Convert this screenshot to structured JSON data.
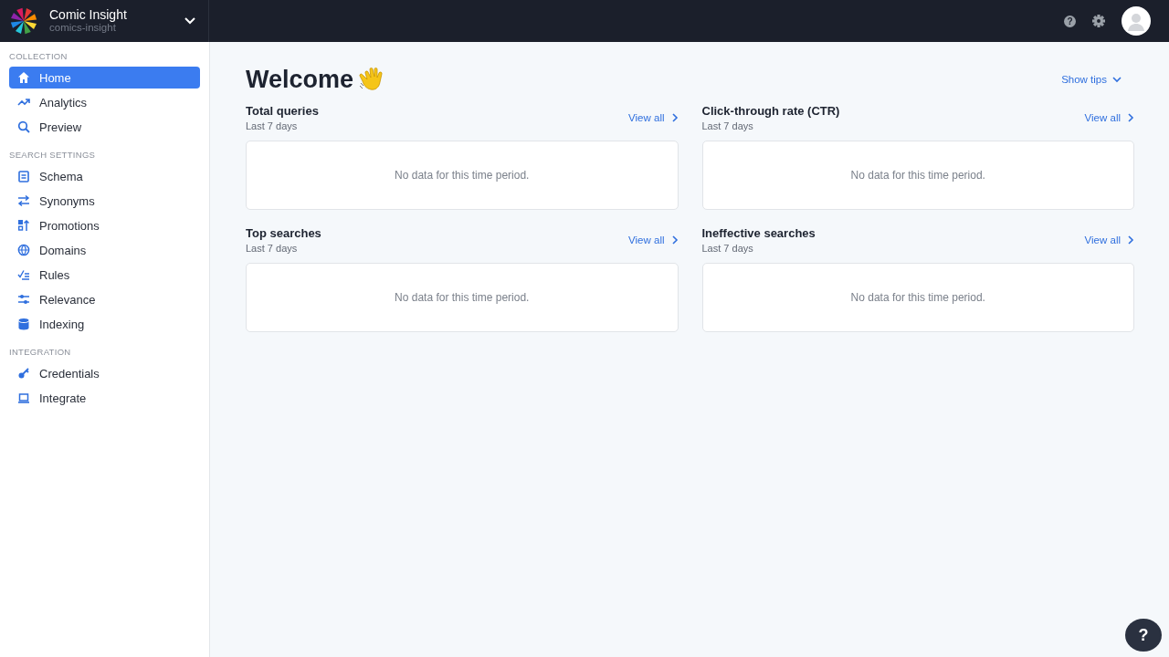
{
  "header": {
    "app_name": "Comic Insight",
    "collection_id": "comics-insight",
    "help": "?"
  },
  "sidebar": {
    "sections": [
      {
        "title": "COLLECTION",
        "items": [
          {
            "label": "Home",
            "selected": true
          },
          {
            "label": "Analytics",
            "selected": false
          },
          {
            "label": "Preview",
            "selected": false
          }
        ]
      },
      {
        "title": "SEARCH SETTINGS",
        "items": [
          {
            "label": "Schema",
            "selected": false
          },
          {
            "label": "Synonyms",
            "selected": false
          },
          {
            "label": "Promotions",
            "selected": false
          },
          {
            "label": "Domains",
            "selected": false
          },
          {
            "label": "Rules",
            "selected": false
          },
          {
            "label": "Relevance",
            "selected": false
          },
          {
            "label": "Indexing",
            "selected": false
          }
        ]
      },
      {
        "title": "INTEGRATION",
        "items": [
          {
            "label": "Credentials",
            "selected": false
          },
          {
            "label": "Integrate",
            "selected": false
          }
        ]
      }
    ]
  },
  "main": {
    "title": "Welcome",
    "show_tips": "Show tips",
    "panels": [
      {
        "title": "Total queries",
        "subtitle": "Last 7 days",
        "link": "View all",
        "empty": "No data for this time period."
      },
      {
        "title": "Click-through rate (CTR)",
        "subtitle": "Last 7 days",
        "link": "View all",
        "empty": "No data for this time period."
      },
      {
        "title": "Top searches",
        "subtitle": "Last 7 days",
        "link": "View all",
        "empty": "No data for this time period."
      },
      {
        "title": "Ineffective searches",
        "subtitle": "Last 7 days",
        "link": "View all",
        "empty": "No data for this time period."
      }
    ]
  },
  "help_button": "?"
}
